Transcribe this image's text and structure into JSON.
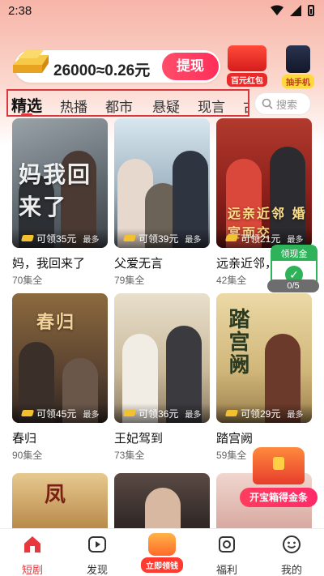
{
  "status_bar": {
    "time": "2:38"
  },
  "banner": {
    "coin_text": "26000≈0.26元",
    "withdraw_label": "提现",
    "promo_red_packet": "百元红包",
    "promo_phone": "抽手机"
  },
  "tabs": {
    "items": [
      "精选",
      "热播",
      "都市",
      "悬疑",
      "现言",
      "古"
    ],
    "active": "精选"
  },
  "search": {
    "placeholder": "搜索"
  },
  "dramas": [
    {
      "title": "妈，我回来了",
      "episodes": "70集全",
      "reward": "可领35元",
      "reward_suffix": "最多",
      "poster_text": "妈我回来了"
    },
    {
      "title": "父爱无言",
      "episodes": "79集全",
      "reward": "可领39元",
      "reward_suffix": "最多",
      "poster_text": ""
    },
    {
      "title": "远亲近邻，",
      "episodes": "42集全",
      "reward": "可领21元",
      "reward_suffix": "最多",
      "poster_text": "远亲近邻 婚宴面交"
    },
    {
      "title": "春归",
      "episodes": "90集全",
      "reward": "可领45元",
      "reward_suffix": "最多",
      "poster_text": "春归"
    },
    {
      "title": "王妃驾到",
      "episodes": "73集全",
      "reward": "可领36元",
      "reward_suffix": "最多",
      "poster_text": ""
    },
    {
      "title": "踏宫阙",
      "episodes": "59集全",
      "reward": "可领29元",
      "reward_suffix": "最多",
      "poster_text": "踏宫阙"
    },
    {
      "title": "",
      "episodes": "",
      "reward": "",
      "reward_suffix": "",
      "poster_text": "凤"
    },
    {
      "title": "",
      "episodes": "",
      "reward": "",
      "reward_suffix": "",
      "poster_text": ""
    },
    {
      "title": "",
      "episodes": "",
      "reward": "",
      "reward_suffix": "",
      "poster_text": ""
    }
  ],
  "claim_widget": {
    "label": "领现金",
    "progress": "0/5"
  },
  "treasure": {
    "label": "开宝箱得金条"
  },
  "bottom_nav": {
    "items": [
      "短剧",
      "发现",
      "福利",
      "我的"
    ],
    "center_label": "立即领钱",
    "active": "短剧"
  },
  "colors": {
    "accent": "#e8383d",
    "claim_green": "#2fb35a",
    "gold": "#f3c030"
  }
}
